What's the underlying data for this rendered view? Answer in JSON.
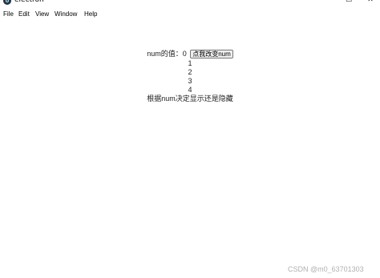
{
  "window": {
    "title": "electron",
    "minimize_glyph": "−",
    "maximize_glyph": "☐",
    "close_glyph": "✕"
  },
  "menu": {
    "items": [
      "File",
      "Edit",
      "View",
      "Window",
      "Help"
    ]
  },
  "main": {
    "num_label": "num的值：",
    "num_value": "0",
    "change_button_label": "点我改变num",
    "list_items": [
      "1",
      "2",
      "3",
      "4"
    ],
    "conditional_text": "根据num决定显示还是隐藏"
  },
  "watermark": "CSDN @m0_63701303"
}
